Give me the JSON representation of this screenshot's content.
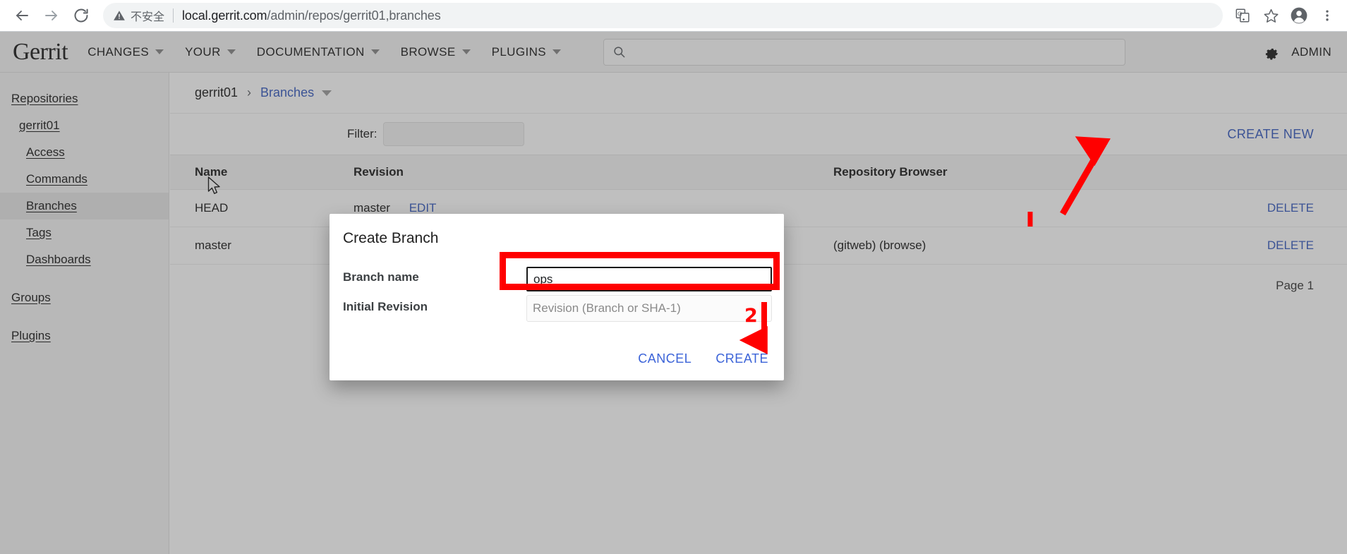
{
  "browser": {
    "back_icon": "back-arrow-icon",
    "forward_icon": "forward-arrow-icon",
    "reload_icon": "reload-icon",
    "security_label": "不安全",
    "url_host": "local.gerrit.com",
    "url_path": "/admin/repos/gerrit01,branches",
    "translate_icon": "translate-icon",
    "bookmark_icon": "star-icon",
    "profile_icon": "profile-avatar-icon",
    "menu_icon": "three-dot-menu-icon"
  },
  "header": {
    "logo": "Gerrit",
    "nav": [
      {
        "label": "CHANGES"
      },
      {
        "label": "YOUR"
      },
      {
        "label": "DOCUMENTATION"
      },
      {
        "label": "BROWSE"
      },
      {
        "label": "PLUGINS"
      }
    ],
    "search_placeholder": "",
    "search_value": "",
    "gear_icon": "gear-icon",
    "admin_label": "ADMIN"
  },
  "sidebar": {
    "items": [
      {
        "label": "Repositories",
        "level": 1,
        "selected": false
      },
      {
        "label": "gerrit01",
        "level": 2,
        "selected": false
      },
      {
        "label": "Access",
        "level": 3,
        "selected": false
      },
      {
        "label": "Commands",
        "level": 3,
        "selected": false
      },
      {
        "label": "Branches",
        "level": 3,
        "selected": true
      },
      {
        "label": "Tags",
        "level": 3,
        "selected": false
      },
      {
        "label": "Dashboards",
        "level": 3,
        "selected": false
      },
      {
        "label": "Groups",
        "level": 1,
        "selected": false
      },
      {
        "label": "Plugins",
        "level": 1,
        "selected": false
      }
    ]
  },
  "breadcrumb": {
    "repo": "gerrit01",
    "separator": "›",
    "section": "Branches"
  },
  "toolbar": {
    "filter_label": "Filter:",
    "filter_value": "",
    "filter_placeholder": "",
    "create_new_label": "CREATE NEW"
  },
  "table": {
    "columns": [
      "Name",
      "Revision",
      "Repository Browser",
      ""
    ],
    "rows": [
      {
        "name": "HEAD",
        "revision": "master",
        "revision_action": "EDIT",
        "browser": "",
        "delete": "DELETE"
      },
      {
        "name": "master",
        "revision": "",
        "revision_action": "",
        "browser": "(gitweb) (browse)",
        "delete": "DELETE"
      }
    ],
    "page_indicator": "Page 1"
  },
  "dialog": {
    "title": "Create Branch",
    "branch_name_label": "Branch name",
    "branch_name_value": "ops",
    "branch_name_placeholder": "",
    "initial_revision_label": "Initial Revision",
    "initial_revision_value": "",
    "initial_revision_placeholder": "Revision (Branch or SHA-1)",
    "cancel_label": "CANCEL",
    "create_label": "CREATE"
  },
  "annotations": {
    "step_2_label": "2",
    "accent_color": "#ff0000"
  }
}
